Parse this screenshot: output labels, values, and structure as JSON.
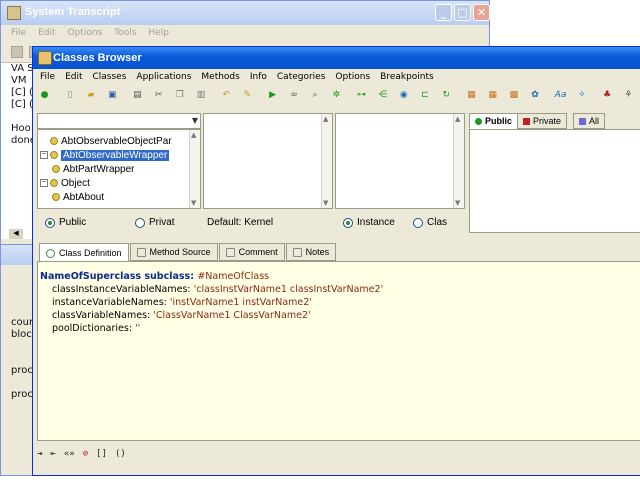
{
  "transcript_window": {
    "title": "System Transcript",
    "menu": [
      "File",
      "Edit",
      "Options",
      "Tools",
      "Help"
    ],
    "visible_text": [
      "VA S",
      "VM",
      "[C] (",
      "[C] (",
      "",
      "Hoo",
      "done"
    ]
  },
  "second_window": {
    "visible_text": [
      "cour",
      "bloc",
      "",
      "",
      "proc",
      "",
      "proc"
    ]
  },
  "browser": {
    "title": "Classes Browser",
    "menu": [
      "File",
      "Edit",
      "Classes",
      "Applications",
      "Methods",
      "Info",
      "Categories",
      "Options",
      "Breakpoints"
    ],
    "class_tree": [
      {
        "label": "AbtObservableObjectPar",
        "indent": 1,
        "expandable": false,
        "selected": false
      },
      {
        "label": "AbtObservableWrapper",
        "indent": 0,
        "expandable": true,
        "selected": true
      },
      {
        "label": "AbtPartWrapper",
        "indent": 1,
        "expandable": false,
        "selected": false
      },
      {
        "label": "Object",
        "indent": 0,
        "expandable": true,
        "selected": false
      },
      {
        "label": "AbtAbout",
        "indent": 1,
        "expandable": false,
        "selected": false
      }
    ],
    "scope_radios": {
      "public": "Public",
      "private": "Privat"
    },
    "default_app": "Default: Kernel",
    "side_radios": {
      "instance": "Instance",
      "class": "Clas"
    },
    "visibility_tabs": {
      "public": "Public",
      "private": "Private",
      "all": "All"
    },
    "tabs": [
      "Class Definition",
      "Method Source",
      "Comment",
      "Notes"
    ],
    "code": {
      "line1_receiver": "NameOfSuperclass",
      "line1_message": " subclass: ",
      "line1_arg": "#NameOfClass",
      "line2_key": "classInstanceVariableNames: ",
      "line2_val": "'classInstVarName1 classInstVarName2'",
      "line3_key": "instanceVariableNames: ",
      "line3_val": "'instVarName1 instVarName2'",
      "line4_key": "classVariableNames: ",
      "line4_val": "'ClassVarName1 ClassVarName2'",
      "line5_key": "poolDictionaries: ",
      "line5_val": "''"
    },
    "bottom_tools": [
      "[]",
      "()"
    ]
  }
}
